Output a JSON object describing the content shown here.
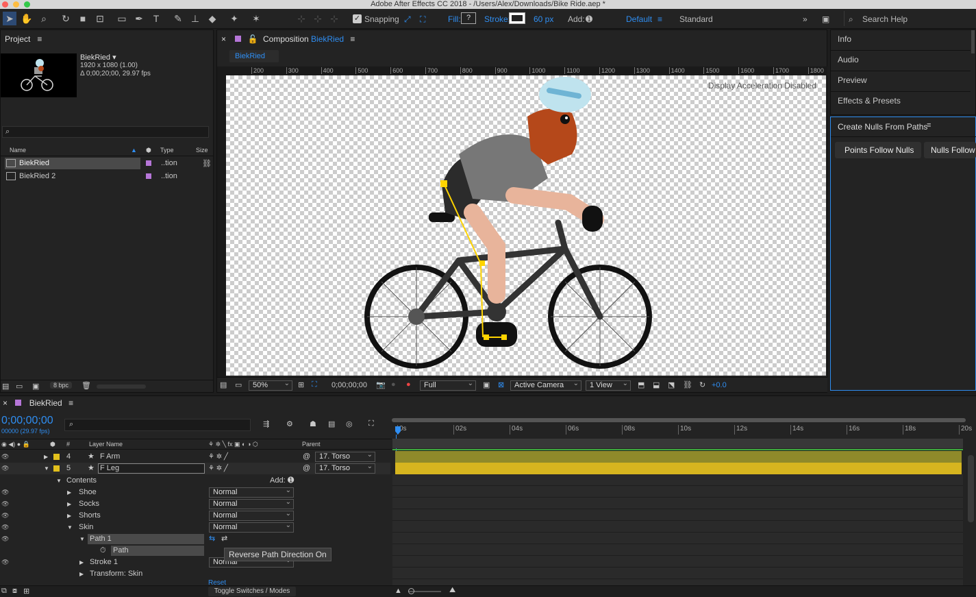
{
  "window": {
    "title": "Adobe After Effects CC 2018 - /Users/Alex/Downloads/Bike Ride.aep *"
  },
  "toolbar": {
    "snapping": "Snapping",
    "fill": "Fill:",
    "fill_value": "?",
    "stroke": "Stroke:",
    "stroke_px": "60 px",
    "add": "Add:",
    "workspace_default": "Default",
    "workspace_standard": "Standard",
    "search": "Search Help"
  },
  "project": {
    "title": "Project",
    "comp_name": "BiekRied ▾",
    "comp_size": "1920 x 1080 (1.00)",
    "comp_dur": "Δ 0;00;20;00, 29.97 fps",
    "search_placeholder": "",
    "col_name": "Name",
    "col_type": "Type",
    "col_size": "Size",
    "items": [
      {
        "name": "BiekRied",
        "type": "..tion"
      },
      {
        "name": "BiekRied 2",
        "type": "..tion"
      }
    ],
    "bpc": "8 bpc"
  },
  "comp": {
    "label": "Composition",
    "name": "BiekRied",
    "tab": "BiekRied",
    "accel": "Display Acceleration Disabled",
    "zoom": "50%",
    "timecode": "0;00;00;00",
    "resolution": "Full",
    "camera": "Active Camera",
    "views": "1 View",
    "exposure": "+0.0",
    "ruler": [
      "200",
      "300",
      "400",
      "500",
      "600",
      "700",
      "800",
      "900",
      "1000",
      "1100",
      "1200",
      "1300",
      "1400",
      "1500",
      "1600",
      "1700",
      "1800"
    ]
  },
  "right": {
    "items": [
      "Info",
      "Audio",
      "Preview",
      "Effects & Presets"
    ],
    "nulls_title": "Create Nulls From Paths",
    "btn1": "Points Follow Nulls",
    "btn2": "Nulls Follow Paths"
  },
  "timeline": {
    "comp": "BiekRied",
    "time": "0;00;00;00",
    "fps": "00000 (29.97 fps)",
    "col_hash": "#",
    "col_layer": "Layer Name",
    "col_parent": "Parent",
    "ticks": [
      "0s",
      "02s",
      "04s",
      "06s",
      "08s",
      "10s",
      "12s",
      "14s",
      "16s",
      "18s",
      "20s"
    ],
    "layers": [
      {
        "num": "4",
        "name": "F Arm",
        "parent": "17. Torso"
      },
      {
        "num": "5",
        "name": "F Leg",
        "parent": "17. Torso"
      }
    ],
    "contents": "Contents",
    "add": "Add:",
    "groups": [
      {
        "name": "Shoe",
        "mode": "Normal"
      },
      {
        "name": "Socks",
        "mode": "Normal"
      },
      {
        "name": "Shorts",
        "mode": "Normal"
      },
      {
        "name": "Skin",
        "mode": "Normal"
      }
    ],
    "path1": "Path 1",
    "path": "Path",
    "stroke1": "Stroke 1",
    "stroke_mode": "Normal",
    "transform": "Transform: Skin",
    "tooltip": "Reverse Path Direction On",
    "toggle": "Toggle Switches / Modes",
    "reset": "Reset"
  }
}
